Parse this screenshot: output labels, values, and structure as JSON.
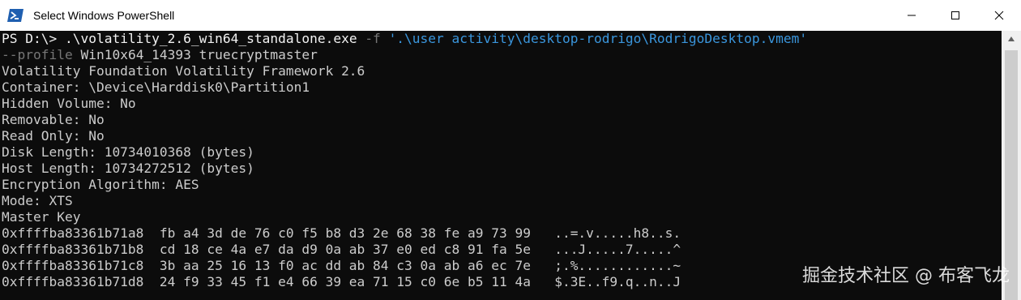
{
  "window": {
    "title": "Select Windows PowerShell",
    "icon": "powershell-icon",
    "controls": [
      "minimize-icon",
      "maximize-icon",
      "close-icon"
    ]
  },
  "console": {
    "prompt": "PS D:\\> ",
    "command": {
      "exe": ".\\volatility_2.6_win64_standalone.exe",
      "flag_f": "-f",
      "path": "'.\\user activity\\desktop-rodrigo\\RodrigoDesktop.vmem'",
      "flag_profile": "--profile",
      "profile": "Win10x64_14393",
      "plugin": "truecryptmaster"
    },
    "output": [
      "Volatility Foundation Volatility Framework 2.6",
      "Container: \\Device\\Harddisk0\\Partition1",
      "Hidden Volume: No",
      "Removable: No",
      "Read Only: No",
      "Disk Length: 10734010368 (bytes)",
      "Host Length: 10734272512 (bytes)",
      "Encryption Algorithm: AES",
      "Mode: XTS",
      "Master Key",
      "0xffffba83361b71a8  fb a4 3d de 76 c0 f5 b8 d3 2e 68 38 fe a9 73 99   ..=.v.....h8..s.",
      "0xffffba83361b71b8  cd 18 ce 4a e7 da d9 0a ab 37 e0 ed c8 91 fa 5e   ...J.....7.....^",
      "0xffffba83361b71c8  3b aa 25 16 13 f0 ac dd ab 84 c3 0a ab a6 ec 7e   ;.%............~",
      "0xffffba83361b71d8  24 f9 33 45 f1 e4 66 39 ea 71 15 c0 6e b5 11 4a   $.3E..f9.q..n..J"
    ]
  },
  "watermark": "掘金技术社区 @ 布客飞龙",
  "colors": {
    "console_bg": "#0c0c0c",
    "text": "#cccccc",
    "string": "#3a96dd",
    "flag": "#767676"
  }
}
